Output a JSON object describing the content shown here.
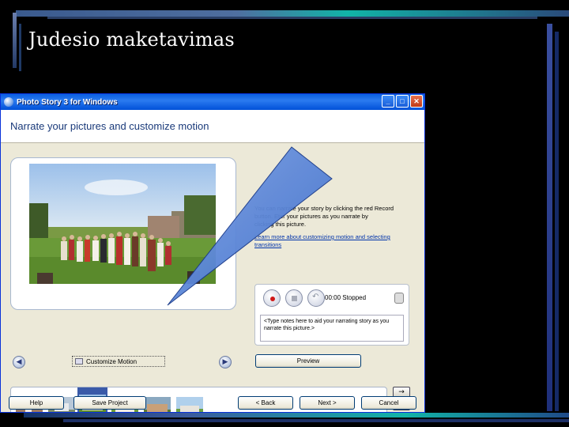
{
  "slide": {
    "title": "Judesio maketavimas"
  },
  "window": {
    "title": "Photo Story 3 for Windows",
    "buttons": {
      "minimize": "_",
      "maximize": "□",
      "close": "✕"
    }
  },
  "header": {
    "title": "Narrate your pictures and customize motion"
  },
  "preview": {
    "prev_icon": "chevron-left-icon",
    "next_icon": "chevron-right-icon",
    "customize_motion_label": "Customize Motion"
  },
  "instructions": {
    "text_line1": "You can narrate your story by clicking the red Record",
    "text_line2": "button. Eter     your pictures as you narrate by",
    "text_line3": "clicking       this picture.",
    "link": "Learn more about customizing motion and selecting",
    "link_line2": "transitions"
  },
  "recorder": {
    "record_icon": "record-icon",
    "stop_icon": "stop-icon",
    "undo_icon": "undo-icon",
    "timer": "00:00 Stopped",
    "mic_icon": "microphone-icon",
    "notes_placeholder": "<Type notes here to aid your narrating story as you narrate this picture.>"
  },
  "buttons": {
    "preview": "Preview",
    "help": "Help",
    "save_project": "Save Project",
    "back": "< Back",
    "next": "Next >",
    "cancel": "Cancel"
  },
  "filmstrip": {
    "side_buttons": [
      "→",
      "←",
      "✕"
    ],
    "selected_index": 2
  },
  "colors": {
    "accent": "#0a5ee0",
    "callout": "#5b86d6",
    "record": "#d01818"
  }
}
